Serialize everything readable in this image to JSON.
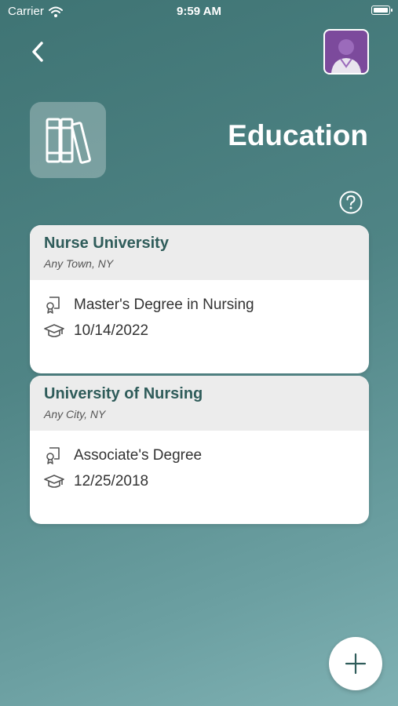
{
  "status_bar": {
    "carrier": "Carrier",
    "time": "9:59 AM"
  },
  "header": {
    "title": "Education"
  },
  "icons": {
    "back": "chevron-left-icon",
    "avatar": "nurse-avatar",
    "section": "books-icon",
    "help": "question-circle-icon",
    "degree": "diploma-icon",
    "date": "graduation-cap-icon",
    "add": "plus-icon"
  },
  "colors": {
    "accent": "#2f5c5a",
    "background_top": "#3f7474",
    "background_bottom": "#7fb1b3",
    "avatar": "#7c4a9c"
  },
  "education": [
    {
      "school": "Nurse University",
      "location": "Any Town, NY",
      "degree": "Master's Degree in Nursing",
      "date": "10/14/2022"
    },
    {
      "school": "University of Nursing",
      "location": "Any City, NY",
      "degree": "Associate's Degree",
      "date": "12/25/2018"
    }
  ]
}
